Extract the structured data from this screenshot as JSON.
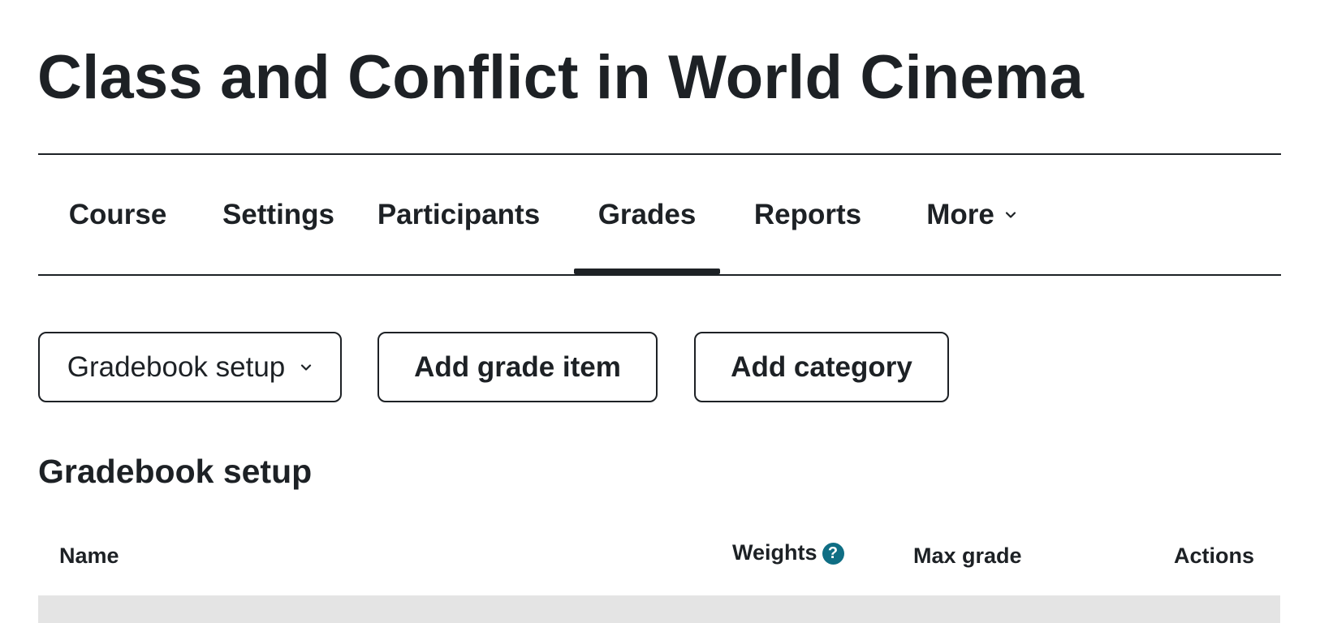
{
  "course": {
    "title": "Class and Conflict in World Cinema"
  },
  "nav": {
    "items": [
      {
        "label": "Course"
      },
      {
        "label": "Settings"
      },
      {
        "label": "Participants"
      },
      {
        "label": "Grades"
      },
      {
        "label": "Reports"
      },
      {
        "label": "More"
      }
    ],
    "active": "Grades"
  },
  "toolbar": {
    "select_label": "Gradebook setup",
    "add_item_label": "Add grade item",
    "add_category_label": "Add category"
  },
  "section": {
    "title": "Gradebook setup"
  },
  "table": {
    "headers": {
      "name": "Name",
      "weights": "Weights",
      "max_grade": "Max grade",
      "actions": "Actions"
    }
  },
  "icons": {
    "help": "help-icon",
    "more_chevron": "chevron-down-icon"
  },
  "colors": {
    "text": "#1d2125",
    "help_icon": "#0f6e84",
    "row_band": "#e4e4e4"
  }
}
